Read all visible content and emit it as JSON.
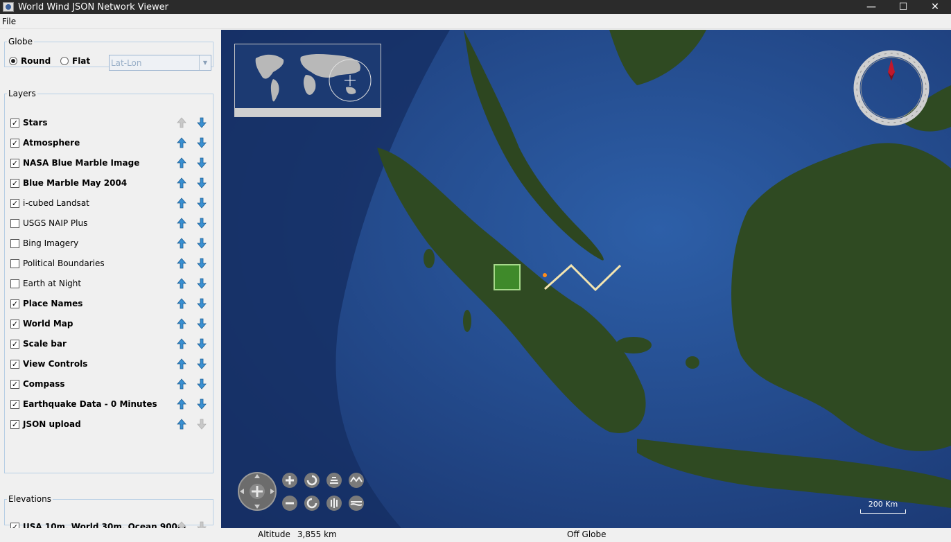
{
  "window": {
    "title": "World Wind JSON Network Viewer",
    "minimize": "—",
    "maximize": "☐",
    "close": "✕"
  },
  "menu": {
    "file": "File"
  },
  "globe": {
    "legend": "Globe",
    "round_label": "Round",
    "flat_label": "Flat",
    "selected": "Round",
    "projection_value": "Lat-Lon"
  },
  "layers": {
    "legend": "Layers",
    "items": [
      {
        "label": "Stars",
        "checked": true,
        "bold": true
      },
      {
        "label": "Atmosphere",
        "checked": true,
        "bold": true
      },
      {
        "label": "NASA Blue Marble Image",
        "checked": true,
        "bold": true
      },
      {
        "label": "Blue Marble May 2004",
        "checked": true,
        "bold": true
      },
      {
        "label": "i-cubed Landsat",
        "checked": true,
        "bold": false
      },
      {
        "label": "USGS NAIP Plus",
        "checked": false,
        "bold": false
      },
      {
        "label": "Bing Imagery",
        "checked": false,
        "bold": false
      },
      {
        "label": "Political Boundaries",
        "checked": false,
        "bold": false
      },
      {
        "label": "Earth at Night",
        "checked": false,
        "bold": false
      },
      {
        "label": "Place Names",
        "checked": true,
        "bold": true
      },
      {
        "label": "World Map",
        "checked": true,
        "bold": true
      },
      {
        "label": "Scale bar",
        "checked": true,
        "bold": true
      },
      {
        "label": "View Controls",
        "checked": true,
        "bold": true
      },
      {
        "label": "Compass",
        "checked": true,
        "bold": true
      },
      {
        "label": "Earthquake Data - 0 Minutes",
        "checked": true,
        "bold": true
      },
      {
        "label": "JSON upload",
        "checked": true,
        "bold": true
      }
    ]
  },
  "elevations": {
    "legend": "Elevations",
    "items": [
      {
        "label": "USA 10m, World 30m, Ocean 900m",
        "checked": true,
        "bold": true
      }
    ]
  },
  "map": {
    "scale_label": "200 Km",
    "colors": {
      "ocean_deep": "#1a3670",
      "ocean_shallow": "#2d5fa8",
      "land": "#2f4a22",
      "shape_fill": "#3f8a2a",
      "path": "#f2e4b0",
      "marker": "#ff8c1a"
    }
  },
  "status": {
    "altitude_label": "Altitude",
    "altitude_value": "3,855 km",
    "position": "Off Globe"
  }
}
